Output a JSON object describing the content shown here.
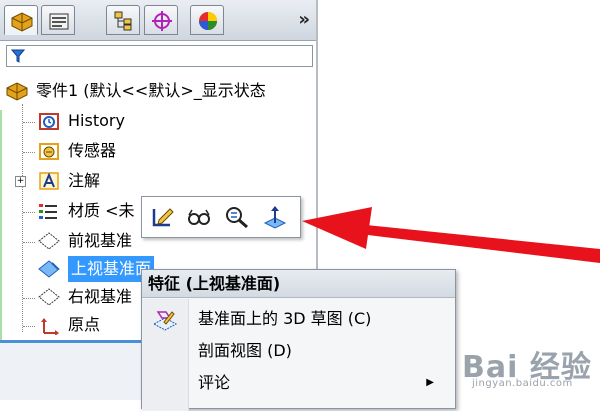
{
  "panel": {
    "tabs": [
      {
        "name": "featuremanager-tab",
        "icon": "featuremanager-icon",
        "active": true
      },
      {
        "name": "propertymanager-tab",
        "icon": "propertymanager-icon",
        "active": false
      },
      {
        "name": "configurationmanager-tab",
        "icon": "configurationmanager-icon",
        "active": false
      },
      {
        "name": "dimxpert-tab",
        "icon": "dimxpert-icon",
        "active": false
      },
      {
        "name": "display-manager-tab",
        "icon": "display-manager-icon",
        "active": false
      }
    ],
    "more_label": "»",
    "filter_icon": "filter-icon"
  },
  "tree": {
    "root": "零件1  (默认<<默认>_显示状态",
    "items": [
      {
        "label": "History",
        "icon": "history-icon"
      },
      {
        "label": "传感器",
        "icon": "sensor-icon"
      },
      {
        "label": "注解",
        "icon": "annotation-icon",
        "expander": "+"
      },
      {
        "label": "材质 <未",
        "icon": "material-icon"
      },
      {
        "label": "前视基准",
        "icon": "plane-icon"
      },
      {
        "label": "上视基准面",
        "icon": "plane-icon",
        "selected": true
      },
      {
        "label": "右视基准",
        "icon": "plane-icon"
      },
      {
        "label": "原点",
        "icon": "origin-icon"
      }
    ]
  },
  "context_toolbar": {
    "icons": [
      "edit-sketch-icon",
      "show-hide-icon",
      "zoom-to-selection-icon",
      "normal-to-icon"
    ]
  },
  "context_menu": {
    "header": "特征 (上视基准面)",
    "items": [
      {
        "label": "基准面上的 3D 草图 (C)",
        "icon": "3d-sketch-on-plane-icon"
      },
      {
        "label": "剖面视图 (D)"
      },
      {
        "label": "评论",
        "submenu": true
      }
    ]
  },
  "watermark": {
    "text": "Bai 经验",
    "url": "jingyan.baidu.com"
  },
  "colors": {
    "selection": "#3399ff",
    "arrow": "#e8121c"
  }
}
